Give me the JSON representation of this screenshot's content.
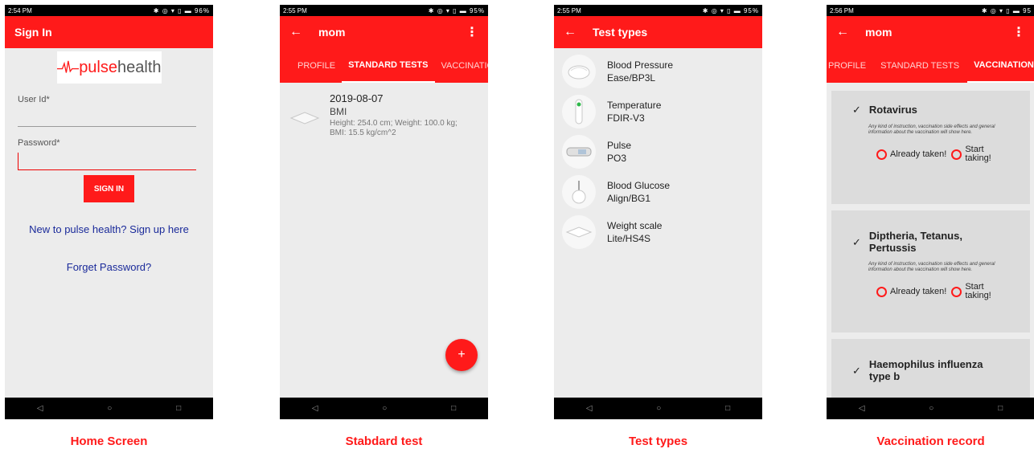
{
  "screens": [
    {
      "status_time": "2:54 PM",
      "status_battery": "96%",
      "title": "Sign In",
      "logo_part1": "pulse",
      "logo_part2": "health",
      "user_label": "User Id*",
      "password_label": "Password*",
      "signin_label": "SIGN IN",
      "signup_link": "New to pulse health? Sign up here",
      "forgot_link": "Forget Password?",
      "caption": "Home Screen"
    },
    {
      "status_time": "2:55 PM",
      "status_battery": "95%",
      "title": "mom",
      "tabs": [
        "PROFILE",
        "STANDARD TESTS",
        "VACCINATIO"
      ],
      "record_date": "2019-08-07",
      "record_type": "BMI",
      "record_detail_1": "Height: 254.0 cm; Weight: 100.0 kg;",
      "record_detail_2": "BMI: 15.5 kg/cm^2",
      "fab_label": "+",
      "caption": "Stabdard test"
    },
    {
      "status_time": "2:55 PM",
      "status_battery": "95%",
      "title": "Test types",
      "tests": [
        {
          "name": "Blood Pressure",
          "model": "Ease/BP3L"
        },
        {
          "name": "Temperature",
          "model": "FDIR-V3"
        },
        {
          "name": "Pulse",
          "model": "PO3"
        },
        {
          "name": "Blood Glucose",
          "model": "Align/BG1"
        },
        {
          "name": "Weight scale",
          "model": "Lite/HS4S"
        }
      ],
      "caption": "Test types"
    },
    {
      "status_time": "2:56 PM",
      "status_battery": "95",
      "title": "mom",
      "tabs": [
        "PROFILE",
        "STANDARD TESTS",
        "VACCINATION"
      ],
      "vaccines": [
        {
          "name": "Rotavirus"
        },
        {
          "name": "Diptheria, Tetanus, Pertussis"
        },
        {
          "name": "Haemophilus influenza type b"
        }
      ],
      "vaccine_info": "Any kind of instruction, vaccination side effects and general information about the vaccination will show here.",
      "opt_taken": "Already taken!",
      "opt_start": "Start taking!",
      "caption": "Vaccination record"
    }
  ],
  "colors": {
    "accent": "#ff1a1a",
    "link": "#1a2a9a",
    "background": "#ececec"
  }
}
